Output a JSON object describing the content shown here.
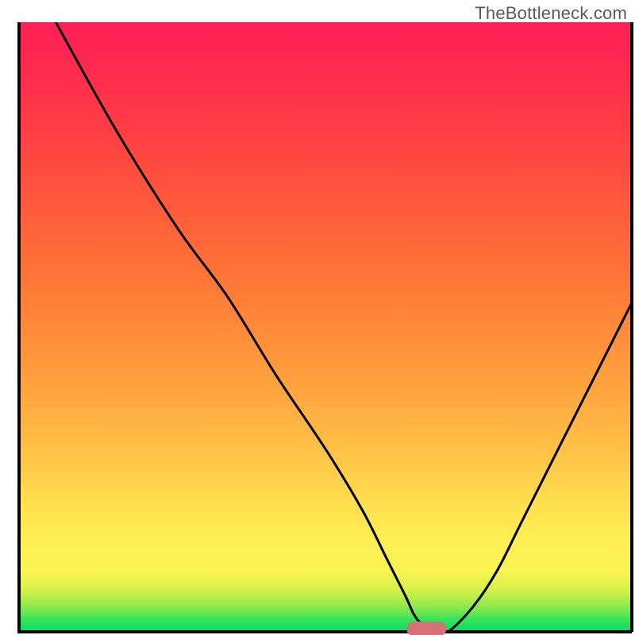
{
  "watermark": "TheBottleneck.com",
  "chart_data": {
    "type": "line",
    "title": "",
    "xlabel": "",
    "ylabel": "",
    "xlim": [
      0,
      100
    ],
    "ylim": [
      0,
      100
    ],
    "background_gradient": {
      "description": "vertical rainbow gradient, bottleneck-percentage colored",
      "stops": [
        {
          "pos": 0.0,
          "color": "#00e26a"
        },
        {
          "pos": 0.02,
          "color": "#36e45a"
        },
        {
          "pos": 0.04,
          "color": "#8ae94c"
        },
        {
          "pos": 0.07,
          "color": "#d8f24a"
        },
        {
          "pos": 0.1,
          "color": "#f9f552"
        },
        {
          "pos": 0.15,
          "color": "#ffef54"
        },
        {
          "pos": 0.2,
          "color": "#ffe250"
        },
        {
          "pos": 0.3,
          "color": "#ffc146"
        },
        {
          "pos": 0.4,
          "color": "#ffa43e"
        },
        {
          "pos": 0.5,
          "color": "#ff8a3a"
        },
        {
          "pos": 0.6,
          "color": "#ff7138"
        },
        {
          "pos": 0.7,
          "color": "#ff5a3b"
        },
        {
          "pos": 0.8,
          "color": "#ff4342"
        },
        {
          "pos": 0.9,
          "color": "#ff2f4c"
        },
        {
          "pos": 1.0,
          "color": "#ff1f56"
        }
      ]
    },
    "series": [
      {
        "name": "bottleneck-curve",
        "x": [
          6,
          16,
          26,
          34,
          42,
          50,
          56,
          60,
          63,
          65,
          68,
          70,
          74,
          78,
          82,
          88,
          94,
          100
        ],
        "y": [
          100,
          82,
          66,
          55,
          42,
          30,
          20,
          12,
          6,
          2,
          0,
          0,
          4,
          10,
          18,
          30,
          42,
          54
        ]
      }
    ],
    "marker": {
      "name": "optimal-point-pill",
      "shape": "rounded-rectangle",
      "color": "#d67079",
      "x_center": 66.5,
      "y_center": 0.5,
      "width": 6.5,
      "height": 2.4
    },
    "axes": {
      "left": {
        "x": 3,
        "color": "#000000"
      },
      "bottom": {
        "y": 0,
        "color": "#000000"
      },
      "right": {
        "x": 100,
        "color": "#000000"
      }
    }
  }
}
